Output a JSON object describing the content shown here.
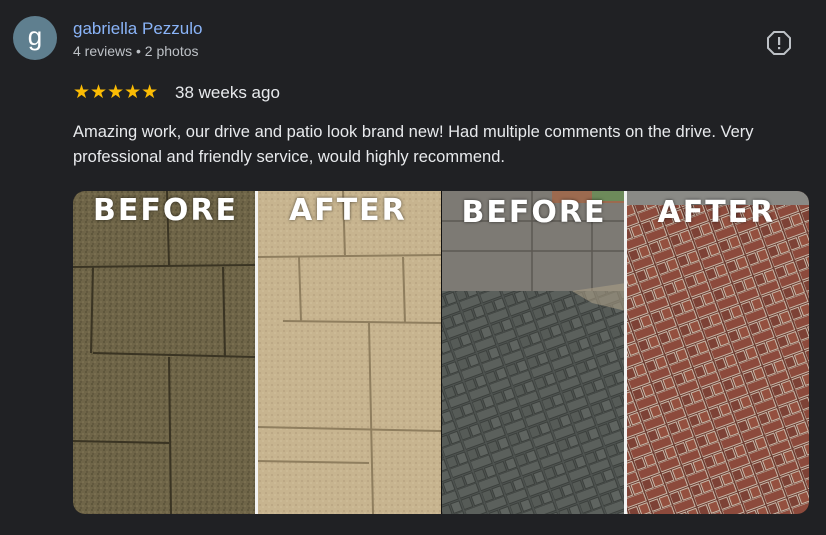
{
  "review": {
    "avatar_letter": "g",
    "reviewer_name": "gabriella Pezzulo",
    "reviewer_meta": "4 reviews • 2 photos",
    "rating": 5,
    "stars_text": "★★★★★",
    "date": "38 weeks ago",
    "text": "Amazing work, our drive and patio look brand new! Had multiple comments on the drive. Very professional and friendly service, would highly recommend."
  },
  "photos": [
    {
      "left_caption": "BEFORE",
      "right_caption": "AFTER",
      "subject": "patio slabs"
    },
    {
      "left_caption": "BEFORE",
      "right_caption": "AFTER",
      "subject": "block paved driveway"
    }
  ],
  "icons": {
    "report": "report-flag-icon"
  },
  "colors": {
    "background": "#202124",
    "name_link": "#8ab4f8",
    "star": "#fbbc04",
    "text": "#e8eaed",
    "secondary_text": "#bdc1c6",
    "avatar": "#5f7f8f"
  }
}
